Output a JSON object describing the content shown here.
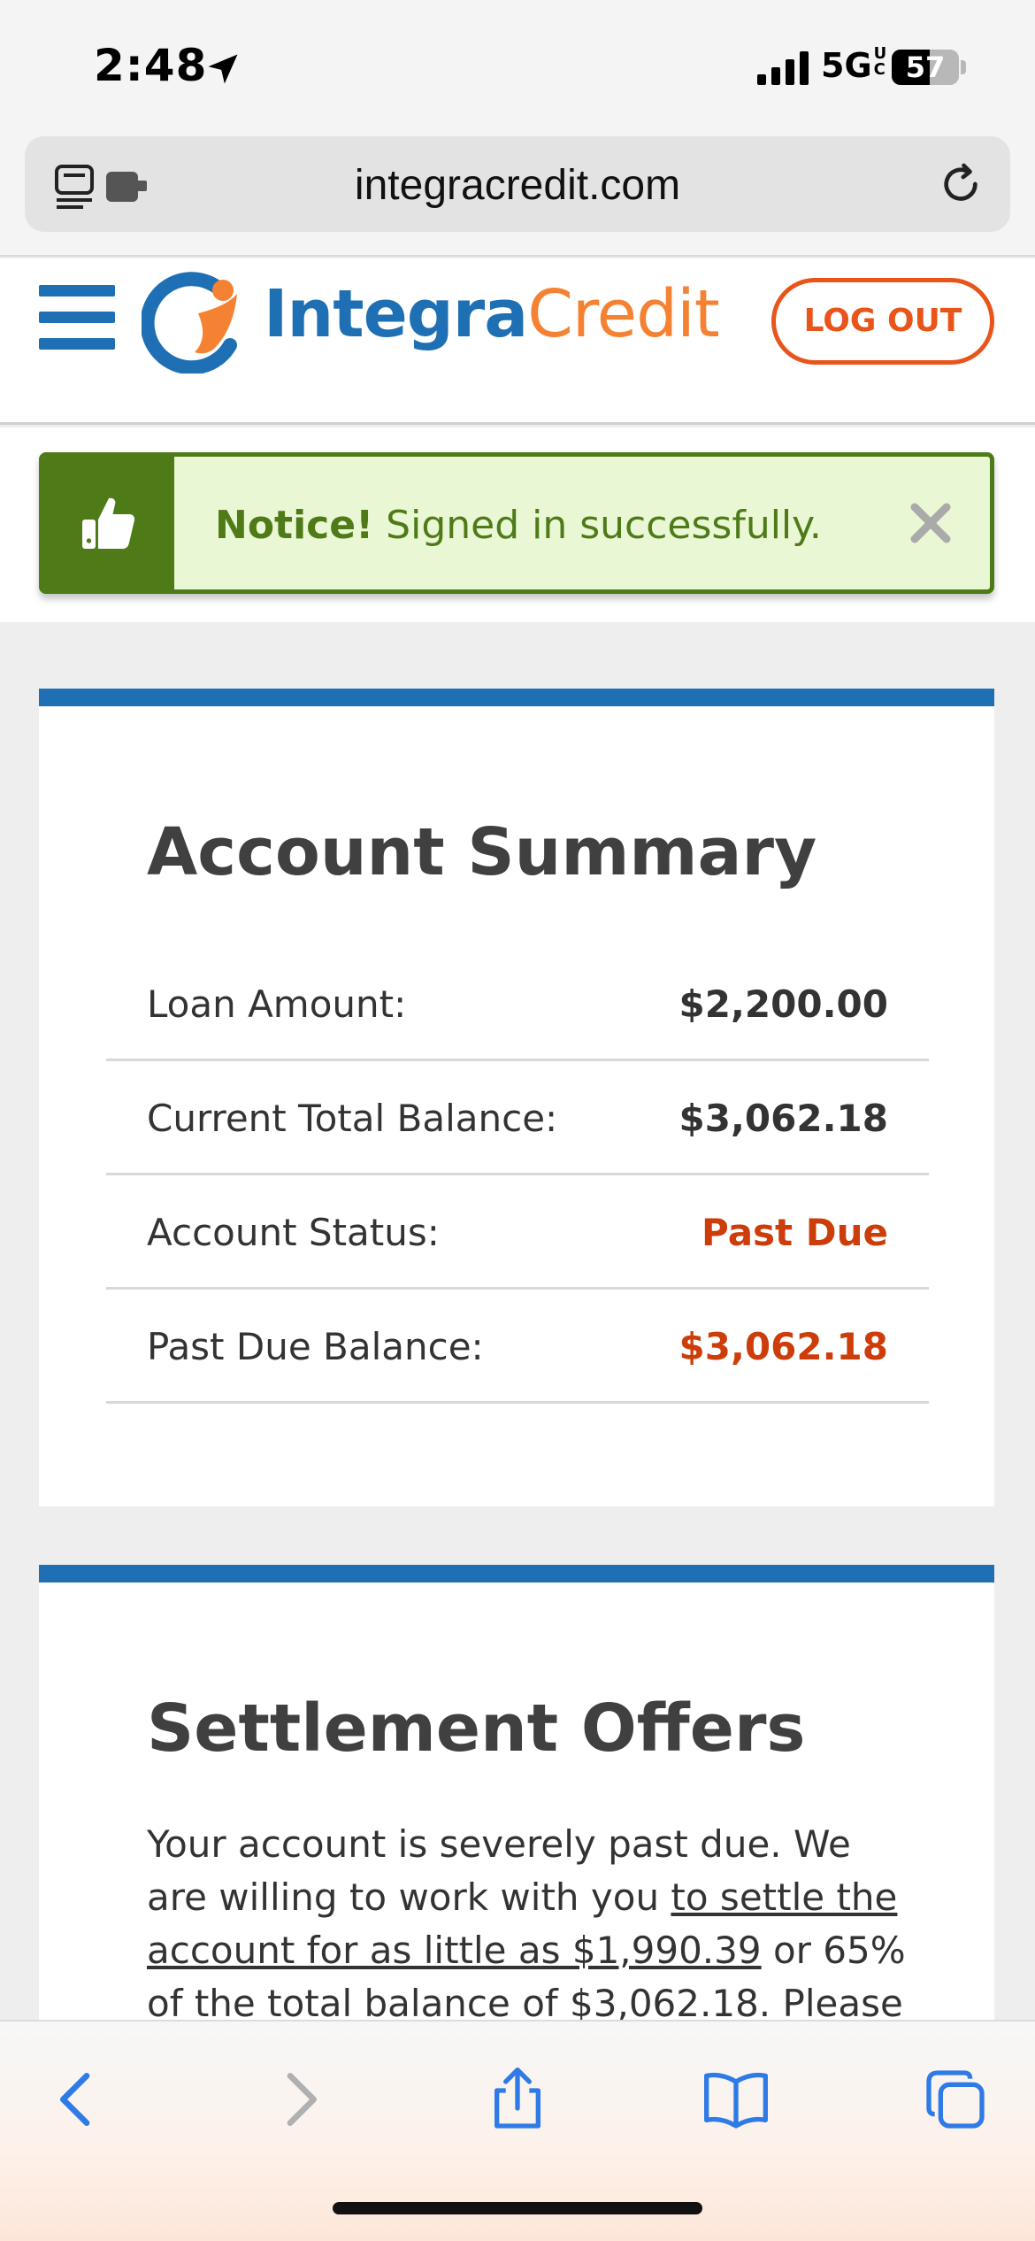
{
  "status_bar": {
    "time": "2:48",
    "network": "5G",
    "network_sup": "UC",
    "battery": "57",
    "battery_level": 0.57
  },
  "browser": {
    "url": "integracredit.com"
  },
  "header": {
    "logo_primary": "Integra",
    "logo_secondary": "Credit",
    "logout_label": "LOG OUT"
  },
  "notice": {
    "title": "Notice!",
    "message": " Signed in successfully."
  },
  "summary": {
    "title": "Account Summary",
    "rows": [
      {
        "label": "Loan Amount:",
        "value": "$2,200.00"
      },
      {
        "label": "Current Total Balance:",
        "value": "$3,062.18"
      },
      {
        "label": "Account Status:",
        "value": "Past Due"
      },
      {
        "label": "Past Due Balance:",
        "value": "$3,062.18"
      }
    ]
  },
  "settlement": {
    "title": "Settlement Offers",
    "text_before": "Your account is severely past due. We are willing to work with you ",
    "link_text": "to settle the account for as little as $1,990.39",
    "text_after": " or 65% of the total balance of $3,062.18. Please"
  },
  "colors": {
    "brand_blue": "#1e6fb3",
    "brand_orange": "#f58232",
    "alert_red": "#cc3d0a",
    "success_green": "#4e7a18"
  }
}
